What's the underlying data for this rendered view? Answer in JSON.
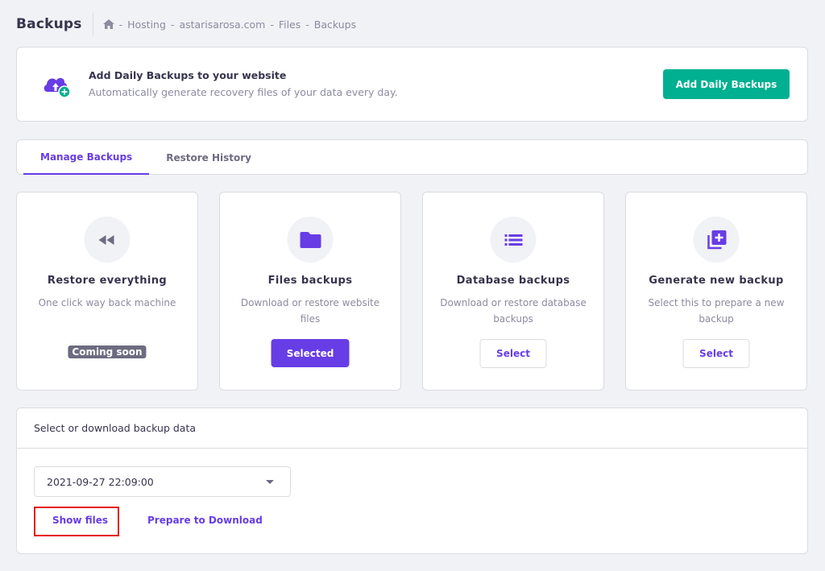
{
  "header": {
    "title": "Backups",
    "breadcrumb": [
      "Hosting",
      "astarisarosa.com",
      "Files",
      "Backups"
    ],
    "breadcrumb_separator": "-"
  },
  "banner": {
    "title": "Add Daily Backups to your website",
    "subtitle": "Automatically generate recovery files of your data every day.",
    "button_label": "Add Daily Backups"
  },
  "tabs": [
    {
      "label": "Manage Backups",
      "active": true
    },
    {
      "label": "Restore History",
      "active": false
    }
  ],
  "options": [
    {
      "icon": "rewind-icon",
      "title": "Restore everything",
      "description": "One click way back machine",
      "action": "Coming soon",
      "state": "disabled"
    },
    {
      "icon": "folder-icon",
      "title": "Files backups",
      "description": "Download or restore website files",
      "action": "Selected",
      "state": "selected"
    },
    {
      "icon": "list-icon",
      "title": "Database backups",
      "description": "Download or restore database backups",
      "action": "Select",
      "state": "default"
    },
    {
      "icon": "add-library-icon",
      "title": "Generate new backup",
      "description": "Select this to prepare a new backup",
      "action": "Select",
      "state": "default"
    }
  ],
  "backup_data": {
    "heading": "Select or download backup data",
    "selected_date": "2021-09-27 22:09:00",
    "show_files_label": "Show files",
    "prepare_label": "Prepare to Download"
  },
  "colors": {
    "primary": "#673de6",
    "success": "#00b090",
    "highlight": "#e5131a",
    "background": "#f1f2f6"
  }
}
